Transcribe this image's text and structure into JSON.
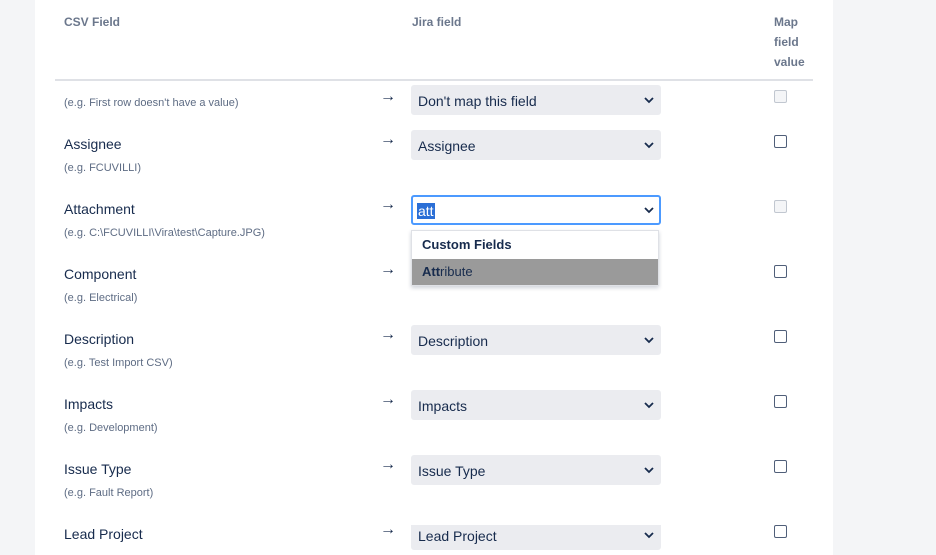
{
  "headers": {
    "csv_field": "CSV Field",
    "jira_field": "Jira field",
    "map_value_line1": "Map",
    "map_value_line2": "field",
    "map_value_line3": "value"
  },
  "arrow_glyph": "→",
  "rows": [
    {
      "name": "",
      "example": "(e.g.  First row doesn't have a value)",
      "jira": "Don't map this field",
      "checkbox_enabled": false
    },
    {
      "name": "Assignee",
      "example": "(e.g.  FCUVILLI)",
      "jira": "Assignee",
      "checkbox_enabled": true
    },
    {
      "name": "Attachment",
      "example": "(e.g.  C:\\FCUVILLI\\Vira\\test\\Capture.JPG)",
      "jira": "att",
      "checkbox_enabled": false
    },
    {
      "name": "Component",
      "example": "(e.g.  Electrical)",
      "jira": "",
      "checkbox_enabled": true
    },
    {
      "name": "Description",
      "example": "(e.g.  Test Import CSV)",
      "jira": "Description",
      "checkbox_enabled": true
    },
    {
      "name": "Impacts",
      "example": "(e.g.  Development)",
      "jira": "Impacts",
      "checkbox_enabled": true
    },
    {
      "name": "Issue Type",
      "example": "(e.g.  Fault Report)",
      "jira": "Issue Type",
      "checkbox_enabled": true
    },
    {
      "name": "Lead Project",
      "example": "",
      "jira": "Lead Project",
      "checkbox_enabled": true
    }
  ],
  "dropdown": {
    "heading": "Custom Fields",
    "item_match": "Att",
    "item_rest": "ribute"
  }
}
